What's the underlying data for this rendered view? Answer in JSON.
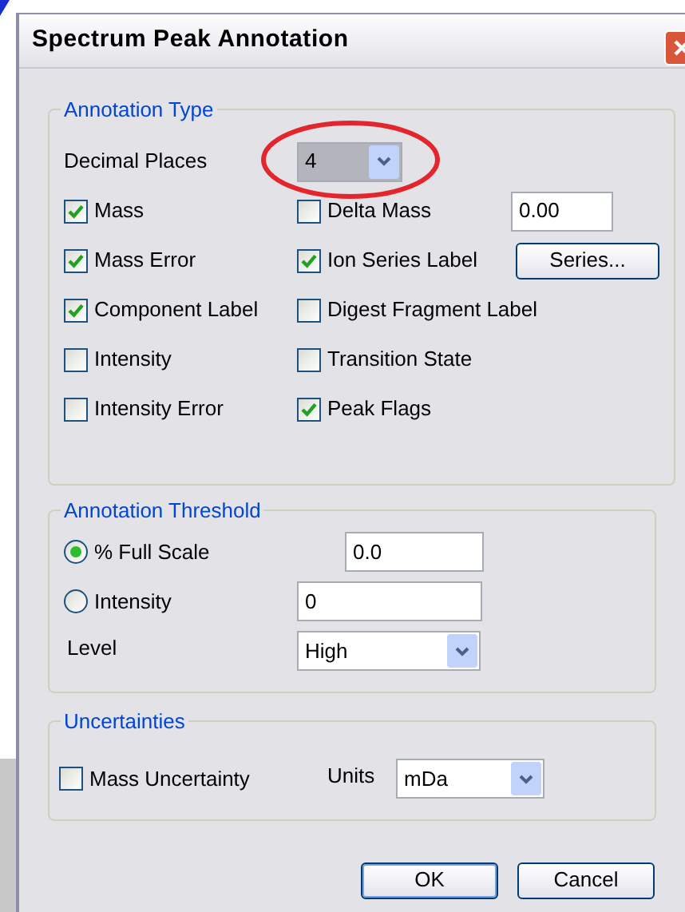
{
  "window": {
    "title": "Spectrum Peak Annotation"
  },
  "annotation_type": {
    "title": "Annotation Type",
    "decimal_places": {
      "label": "Decimal Places",
      "value": "4",
      "highlighted": true
    },
    "options": [
      {
        "label": "Mass",
        "checked": true
      },
      {
        "label": "Delta Mass",
        "checked": false
      },
      {
        "label": "Mass Error",
        "checked": true
      },
      {
        "label": "Ion Series Label",
        "checked": true
      },
      {
        "label": "Component Label",
        "checked": true
      },
      {
        "label": "Digest Fragment Label",
        "checked": false
      },
      {
        "label": "Intensity",
        "checked": false
      },
      {
        "label": "Transition State",
        "checked": false
      },
      {
        "label": "Intensity Error",
        "checked": false
      },
      {
        "label": "Peak Flags",
        "checked": true
      }
    ],
    "delta_mass_value": "0.00",
    "series_button": "Series..."
  },
  "annotation_threshold": {
    "title": "Annotation Threshold",
    "options": [
      {
        "label": "% Full Scale",
        "selected": true,
        "value": "0.0"
      },
      {
        "label": "Intensity",
        "selected": false,
        "value": "0"
      }
    ],
    "level": {
      "label": "Level",
      "value": "High"
    }
  },
  "uncertainties": {
    "title": "Uncertainties",
    "mass_uncertainty": {
      "label": "Mass Uncertainty",
      "checked": false
    },
    "units": {
      "label": "Units",
      "value": "mDa"
    }
  },
  "buttons": [
    {
      "label": "OK",
      "default": true
    },
    {
      "label": "Cancel",
      "default": false
    }
  ]
}
